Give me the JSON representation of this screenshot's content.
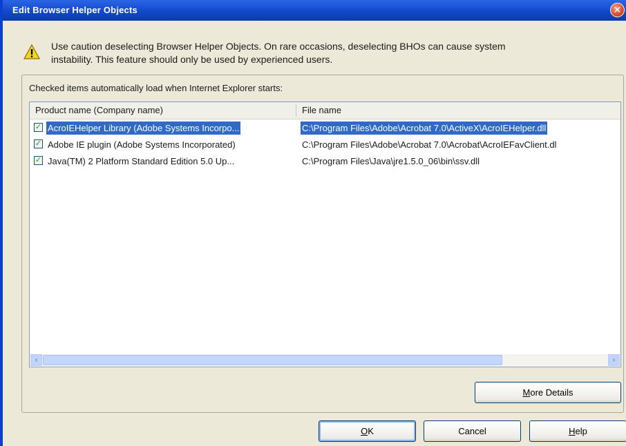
{
  "window": {
    "title": "Edit Browser Helper Objects",
    "close_symbol": "✕"
  },
  "warning": {
    "icon": "warning-icon",
    "text_line1": "Use caution deselecting Browser Helper Objects. On rare occasions, deselecting BHOs can cause system",
    "text_line2": "instability.  This feature should only be used by experienced users."
  },
  "group": {
    "label": "Checked items automatically load when Internet Explorer starts:"
  },
  "list": {
    "columns": {
      "product": "Product name (Company name)",
      "file": "File name"
    },
    "rows": [
      {
        "checked": true,
        "selected": true,
        "name": "AcroIEHelper Library (Adobe Systems Incorpo...",
        "file": "C:\\Program Files\\Adobe\\Acrobat 7.0\\ActiveX\\AcroIEHelper.dll"
      },
      {
        "checked": true,
        "selected": false,
        "name": "Adobe IE plugin (Adobe Systems Incorporated)",
        "file": "C:\\Program Files\\Adobe\\Acrobat 7.0\\Acrobat\\AcroIEFavClient.dl"
      },
      {
        "checked": true,
        "selected": false,
        "name": "Java(TM) 2 Platform Standard Edition 5.0 Up...",
        "file": "C:\\Program Files\\Java\\jre1.5.0_06\\bin\\ssv.dll"
      }
    ],
    "check_glyph": "✓"
  },
  "scrollbar": {
    "left_arrow": "‹",
    "right_arrow": "›"
  },
  "buttons": {
    "more_details": {
      "accel": "M",
      "rest": "ore Details"
    },
    "ok": {
      "accel": "O",
      "rest": "K"
    },
    "cancel": {
      "label": "Cancel"
    },
    "help": {
      "accel": "H",
      "rest": "elp"
    }
  },
  "colors": {
    "titlebar": "#1248c8",
    "selection": "#316ac5",
    "dialog_bg": "#ece9d8"
  }
}
